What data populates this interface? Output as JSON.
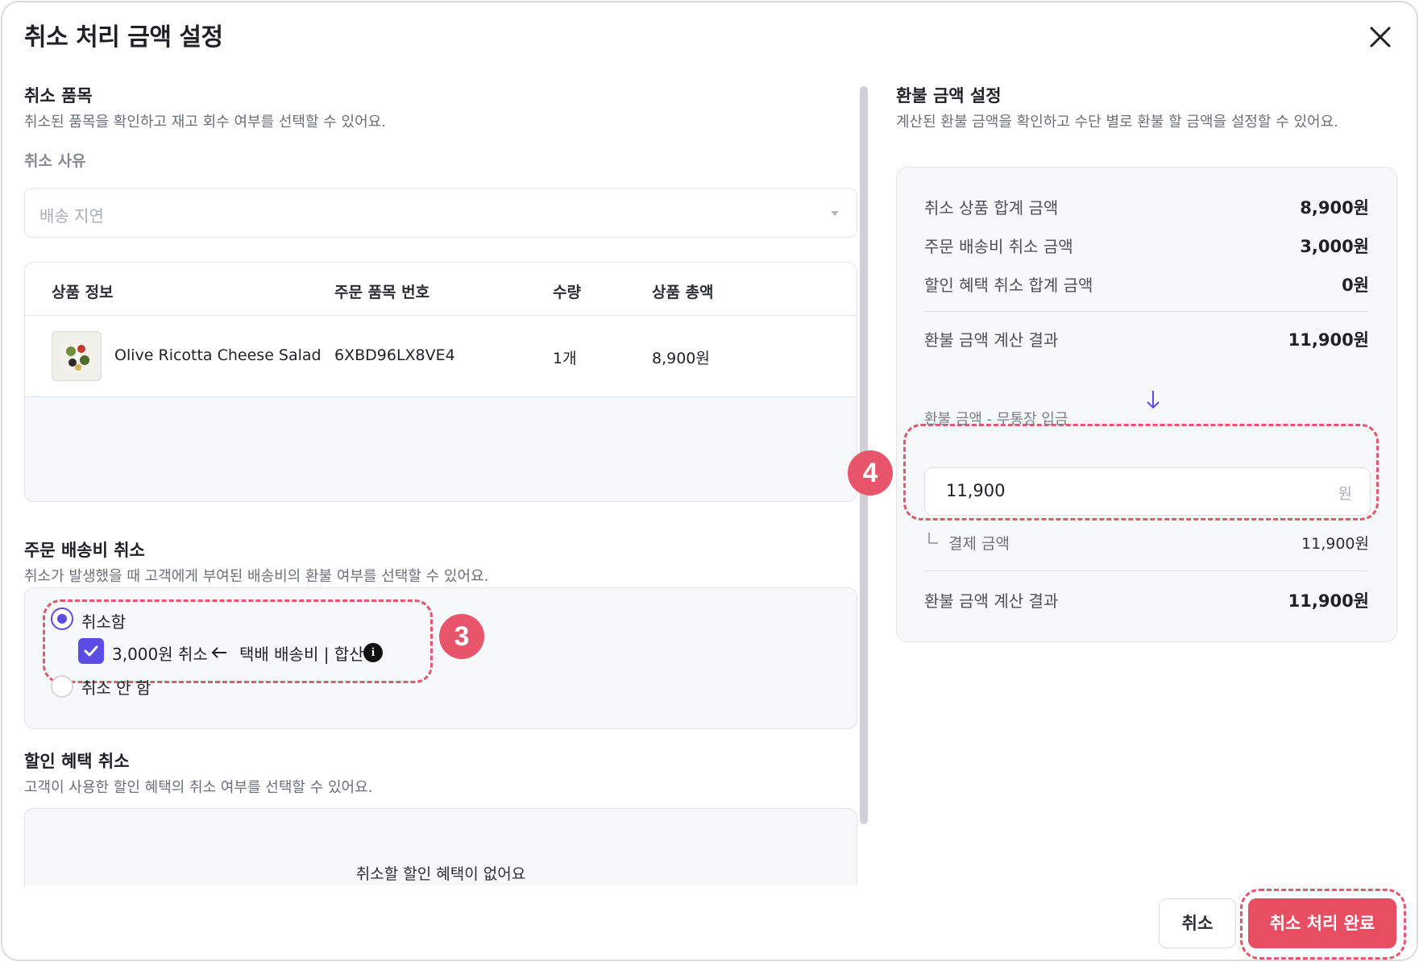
{
  "modal": {
    "title": "취소 처리 금액 설정"
  },
  "cancel_items": {
    "title": "취소 품목",
    "description": "취소된 품목을 확인하고 재고 회수 여부를 선택할 수 있어요.",
    "reason_label": "취소 사유",
    "reason_value": "배송 지연",
    "columns": [
      "상품 정보",
      "주문 품목 번호",
      "수량",
      "상품 총액"
    ],
    "rows": [
      {
        "product": "Olive Ricotta Cheese Salad",
        "item_no": "6XBD96LX8VE4",
        "qty": "1개",
        "total": "8,900원"
      }
    ]
  },
  "shipping_cancel": {
    "title": "주문 배송비 취소",
    "description": "취소가 발생했을 때 고객에게 부여된 배송비의 환불 여부를 선택할 수 있어요.",
    "option_cancel": "취소함",
    "option_no_cancel": "취소 안 함",
    "selected": "취소함",
    "checkbox_label": "3,000원 취소",
    "checkbox_checked": true,
    "fee_source": "택배 배송비 | 합산",
    "annotation": "3"
  },
  "discount_cancel": {
    "title": "할인 혜택 취소",
    "description": "고객이 사용한 할인 혜택의 취소 여부를 선택할 수 있어요.",
    "empty_message": "취소할 할인 혜택이 없어요"
  },
  "refund": {
    "title": "환불 금액 설정",
    "description": "계산된 환불 금액을 확인하고 수단 별로 환불 할 금액을 설정할 수 있어요.",
    "lines": [
      {
        "label": "취소 상품 합계 금액",
        "value": "8,900원"
      },
      {
        "label": "주문 배송비 취소 금액",
        "value": "3,000원"
      },
      {
        "label": "할인 혜택 취소 합계 금액",
        "value": "0원"
      }
    ],
    "calc_label": "환불 금액 계산 결과",
    "calc_value": "11,900원",
    "method_label": "환불 금액 - 무통장 입금",
    "method_value": "11,900",
    "method_unit": "원",
    "payment_label": "결제 금액",
    "payment_value": "11,900원",
    "final_label": "환불 금액 계산 결과",
    "final_value": "11,900원",
    "annotation": "4"
  },
  "footer": {
    "cancel_label": "취소",
    "done_label": "취소 처리 완료"
  },
  "colors": {
    "accent": "#5b4ce6",
    "danger": "#e84e62",
    "annotation": "#e1596d"
  }
}
